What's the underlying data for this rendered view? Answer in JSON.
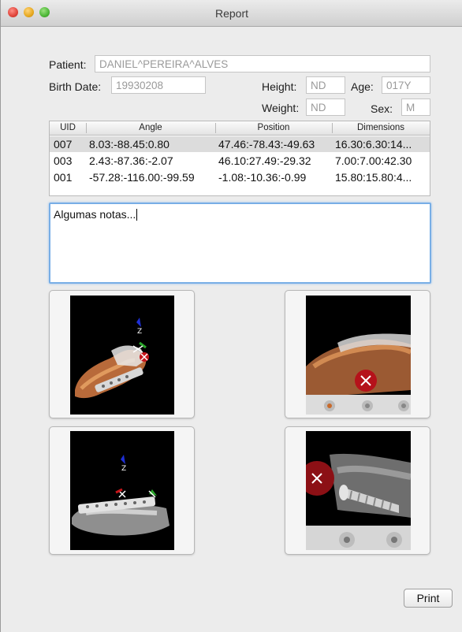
{
  "window": {
    "title": "Report"
  },
  "patient": {
    "patient_label": "Patient:",
    "patient_value": "DANIEL^PEREIRA^ALVES",
    "birth_label": "Birth Date:",
    "birth_value": "19930208",
    "height_label": "Height:",
    "height_value": "ND",
    "age_label": "Age:",
    "age_value": "017Y",
    "weight_label": "Weight:",
    "weight_value": "ND",
    "sex_label": "Sex:",
    "sex_value": "M"
  },
  "table": {
    "headers": [
      "UID",
      "Angle",
      "Position",
      "Dimensions"
    ],
    "rows": [
      [
        "007",
        "8.03:-88.45:0.80",
        "47.46:-78.43:-49.63",
        "16.30:6.30:14..."
      ],
      [
        "003",
        "2.43:-87.36:-2.07",
        "46.10:27.49:-29.32",
        "7.00:7.00:42.30"
      ],
      [
        "001",
        "-57.28:-116.00:-99.59",
        "-1.08:-10.36:-0.99",
        "15.80:15.80:4..."
      ]
    ]
  },
  "notes": {
    "text": "Algumas notas..."
  },
  "thumbnails": [
    {
      "icon": "foot-3d-render-icon"
    },
    {
      "icon": "screw-closeup-render-icon"
    },
    {
      "icon": "foot-xray-plate-icon"
    },
    {
      "icon": "screw-xray-closeup-icon"
    }
  ],
  "actions": {
    "print_label": "Print"
  },
  "colors": {
    "selected_row": "#dcdcdc",
    "focus_ring": "#78aee6"
  }
}
